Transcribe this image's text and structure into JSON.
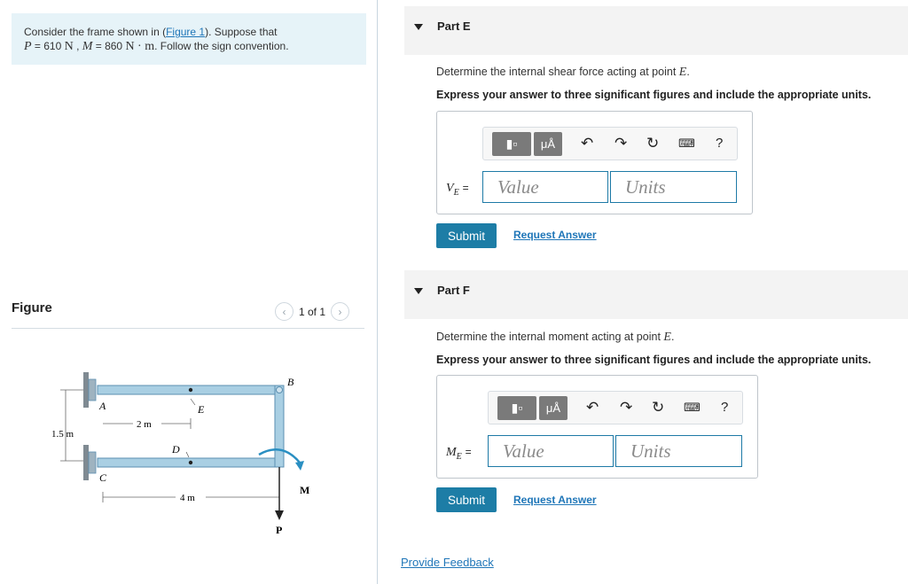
{
  "problem": {
    "prefix": "Consider the frame shown in (",
    "figure_link": "Figure 1",
    "suffix": "). Suppose that",
    "P_symbol": "P",
    "P_value": " = 610 ",
    "P_unit": "N",
    "M_symbol": "M",
    "M_value": " = 860 ",
    "M_unit": "N · m",
    "ending": ". Follow the sign convention."
  },
  "figure_panel": {
    "title": "Figure",
    "counter": "1 of 1",
    "prev_icon": "chevron-left-icon",
    "next_icon": "chevron-right-icon",
    "labels": {
      "A": "A",
      "B": "B",
      "C": "C",
      "D": "D",
      "E": "E",
      "dim_2m": "2 m",
      "dim_4m": "4 m",
      "dim_15m": "1.5 m",
      "M": "M",
      "P": "P"
    },
    "colors": {
      "frame": "#a9cfe3",
      "frame_stroke": "#5b8fb0",
      "support": "#8e9aa3",
      "arrow": "#2a8fc2"
    }
  },
  "parts": [
    {
      "label": "Part E",
      "question_prefix": "Determine the internal shear force acting at point ",
      "point": "E",
      "question_end": ".",
      "instruction": "Express your answer to three significant figures and include the appropriate units.",
      "var_symbol": "V",
      "var_sub": "E",
      "equals": "=",
      "value_placeholder": "Value",
      "units_placeholder": "Units",
      "submit_label": "Submit",
      "request_label": "Request Answer",
      "toolbar_mu": "μÅ",
      "toolbar_help": "?"
    },
    {
      "label": "Part F",
      "question_prefix": "Determine the internal moment acting at point ",
      "point": "E",
      "question_end": ".",
      "instruction": "Express your answer to three significant figures and include the appropriate units.",
      "var_symbol": "M",
      "var_sub": "E",
      "equals": "=",
      "value_placeholder": "Value",
      "units_placeholder": "Units",
      "submit_label": "Submit",
      "request_label": "Request Answer",
      "toolbar_mu": "μÅ",
      "toolbar_help": "?"
    }
  ],
  "feedback_label": "Provide Feedback",
  "colors": {
    "accent": "#1d7da6",
    "link": "#1f76b8",
    "problem_bg": "#e6f3f8",
    "part_header_bg": "#f3f3f3"
  }
}
